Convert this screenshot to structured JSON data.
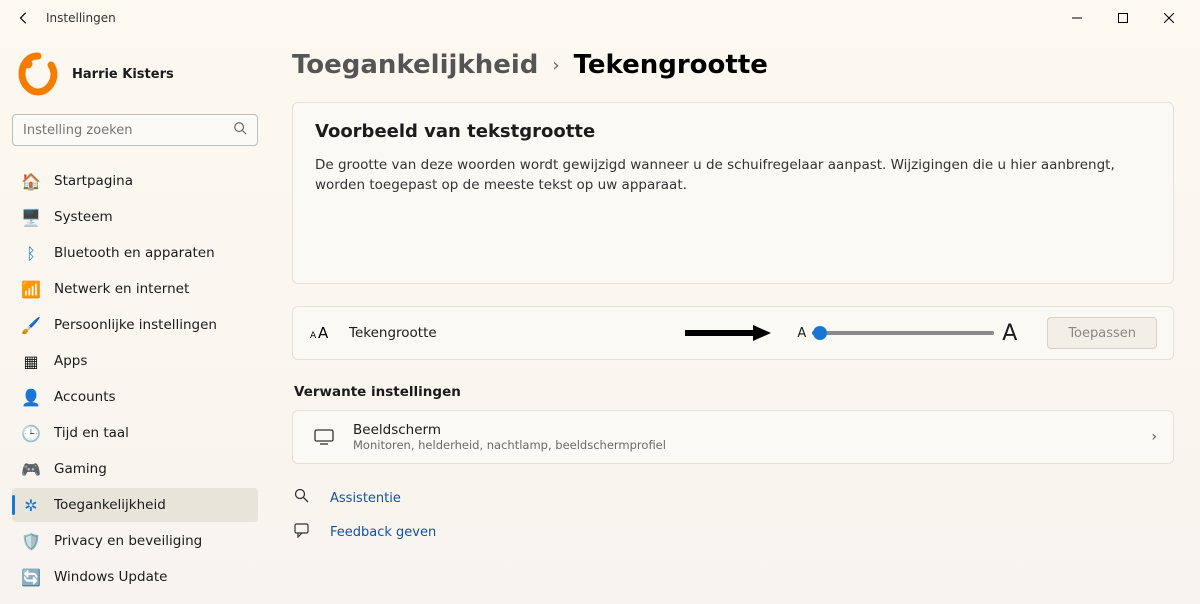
{
  "titlebar": {
    "title": "Instellingen"
  },
  "profile": {
    "name": "Harrie Kisters"
  },
  "search": {
    "placeholder": "Instelling zoeken"
  },
  "nav": {
    "items": [
      {
        "label": "Startpagina"
      },
      {
        "label": "Systeem"
      },
      {
        "label": "Bluetooth en apparaten"
      },
      {
        "label": "Netwerk en internet"
      },
      {
        "label": "Persoonlijke instellingen"
      },
      {
        "label": "Apps"
      },
      {
        "label": "Accounts"
      },
      {
        "label": "Tijd en taal"
      },
      {
        "label": "Gaming"
      },
      {
        "label": "Toegankelijkheid"
      },
      {
        "label": "Privacy en beveiliging"
      },
      {
        "label": "Windows Update"
      }
    ]
  },
  "breadcrumb": {
    "parent": "Toegankelijkheid",
    "current": "Tekengrootte"
  },
  "preview": {
    "heading": "Voorbeeld van tekstgrootte",
    "body": "De grootte van deze woorden wordt gewijzigd wanneer u de schuifregelaar aanpast. Wijzigingen die u hier aanbrengt, worden toegepast op de meeste tekst op uw apparaat."
  },
  "textsize": {
    "label": "Tekengrootte",
    "small_a": "A",
    "large_a": "A",
    "apply": "Toepassen"
  },
  "related": {
    "heading": "Verwante instellingen",
    "display": {
      "title": "Beeldscherm",
      "subtitle": "Monitoren, helderheid, nachtlamp, beeldschermprofiel"
    }
  },
  "help": {
    "assist": "Assistentie",
    "feedback": "Feedback geven"
  }
}
